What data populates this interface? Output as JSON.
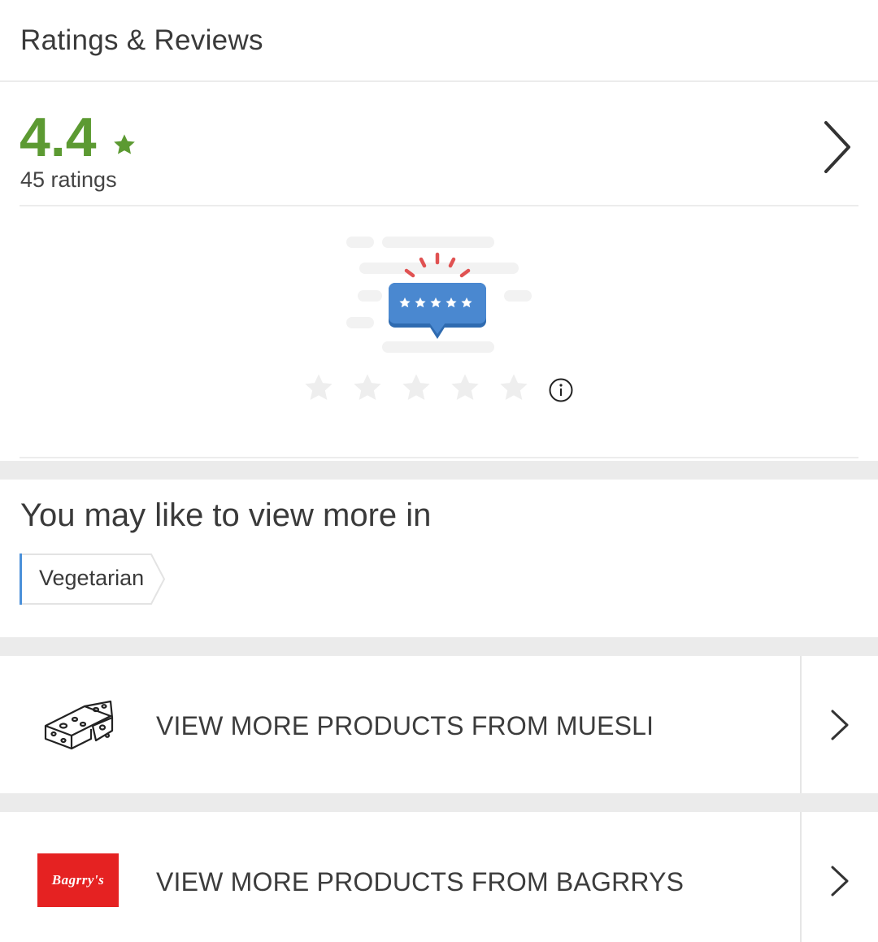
{
  "header": {
    "title": "Ratings & Reviews"
  },
  "rating": {
    "value": "4.4",
    "count_text": "45 ratings",
    "star_color": "#5c9a32"
  },
  "user_rating": {
    "stars_total": 5,
    "stars_selected": 0,
    "info_icon": "info-icon"
  },
  "recommend": {
    "title": "You may like to view more in",
    "tags": [
      {
        "label": "Vegetarian"
      }
    ]
  },
  "links": [
    {
      "label": "VIEW MORE PRODUCTS FROM MUESLI",
      "icon": "cheese-icon"
    },
    {
      "label": "VIEW MORE PRODUCTS FROM BAGRRYS",
      "icon": "brand-logo",
      "logo_text": "Bagrry's",
      "logo_color": "#e52222"
    }
  ],
  "colors": {
    "accent_green": "#5c9a32",
    "tag_accent": "#4a90d9",
    "review_bubble": "#3f7bc2",
    "burst_red": "#e05252"
  }
}
